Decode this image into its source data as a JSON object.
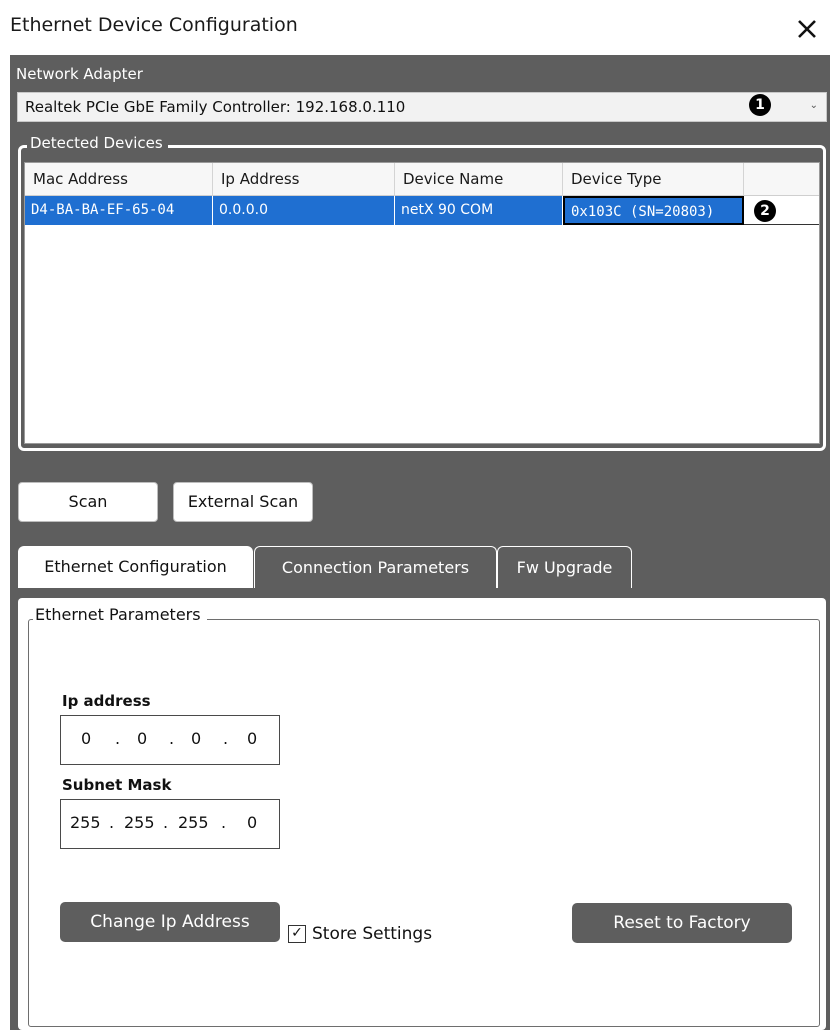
{
  "window": {
    "title": "Ethernet Device Configuration",
    "close_glyph": "✕"
  },
  "network_adapter": {
    "label": "Network Adapter",
    "selected": "Realtek PCIe GbE Family Controller: 192.168.0.110",
    "marker": "1"
  },
  "detected_devices": {
    "legend": "Detected Devices",
    "columns": [
      "Mac Address",
      "Ip Address",
      "Device Name",
      "Device Type"
    ],
    "rows": [
      {
        "mac": "D4-BA-BA-EF-65-04",
        "ip": "0.0.0.0",
        "name": "netX 90 COM",
        "type": "0x103C (SN=20803)"
      }
    ],
    "marker": "2"
  },
  "buttons": {
    "scan": "Scan",
    "external_scan": "External Scan"
  },
  "tabs": [
    {
      "label": "Ethernet Configuration",
      "active": true
    },
    {
      "label": "Connection Parameters",
      "active": false
    },
    {
      "label": "Fw Upgrade",
      "active": false
    }
  ],
  "ethernet_parameters": {
    "legend": "Ethernet Parameters",
    "ip_label": "Ip address",
    "ip": [
      "0",
      "0",
      "0",
      "0"
    ],
    "mask_label": "Subnet Mask",
    "mask": [
      "255",
      "255",
      "255",
      "0"
    ],
    "dot": ".",
    "change_ip_button": "Change Ip Address",
    "store_settings_label": "Store Settings",
    "store_settings_checked": true,
    "reset_button": "Reset to Factory"
  },
  "colors": {
    "panel": "#5e5e5e",
    "selection": "#1f6fd1"
  }
}
